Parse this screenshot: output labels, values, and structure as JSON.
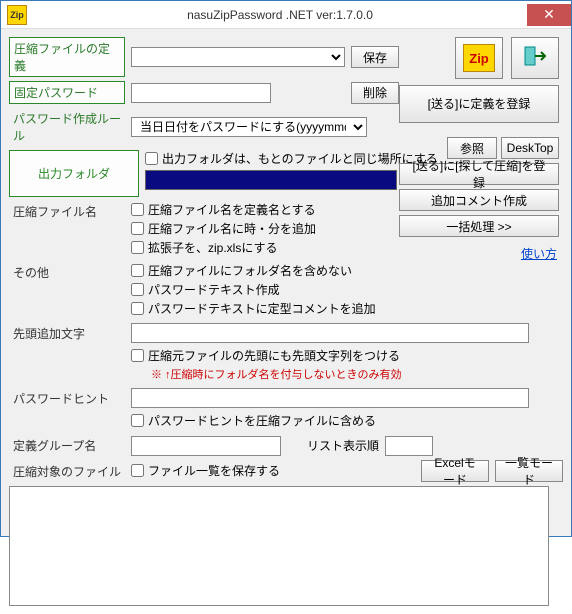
{
  "titlebar": {
    "title": "nasuZipPassword .NET ver:1.7.0.0",
    "icon": "Zip"
  },
  "labels": {
    "def": "圧縮ファイルの定義",
    "fixedpw": "固定パスワード",
    "rule": "パスワード作成ルール",
    "outfolder": "出力フォルダ",
    "zipname": "圧縮ファイル名",
    "other": "その他",
    "prefix": "先頭追加文字",
    "hint": "パスワードヒント",
    "group": "定義グループ名",
    "listorder": "リスト表示順",
    "target": "圧縮対象のファイル"
  },
  "buttons": {
    "save": "保存",
    "del": "削除",
    "register": "[送る]に定義を登録",
    "browse": "参照",
    "desktop": "DeskTop",
    "searchreg": "[送る]に[探して圧縮]を登録",
    "addcomment": "追加コメント作成",
    "batch": "一括処理  >>",
    "howto": "使い方",
    "excel": "Excelモード",
    "list": "一覧モード"
  },
  "dropdowns": {
    "def_value": "",
    "rule_value": "当日日付をパスワードにする(yyyymmdd)"
  },
  "checks": {
    "outsame": "出力フォルダは、もとのファイルと同じ場所にする",
    "c1": "圧縮ファイル名を定義名とする",
    "c2": "圧縮ファイル名に時・分を追加",
    "c3": "拡張子を、zip.xlsにする",
    "c4": "圧縮ファイルにフォルダ名を含めない",
    "c5": "パスワードテキスト作成",
    "c6": "パスワードテキストに定型コメントを追加",
    "c7": "圧縮元ファイルの先頭にも先頭文字列をつける",
    "c8": "パスワードヒントを圧縮ファイルに含める",
    "c9": "ファイル一覧を保存する"
  },
  "note": "※  ↑圧縮時にフォルダ名を付与しないときのみ有効",
  "zipicon": "Zip"
}
